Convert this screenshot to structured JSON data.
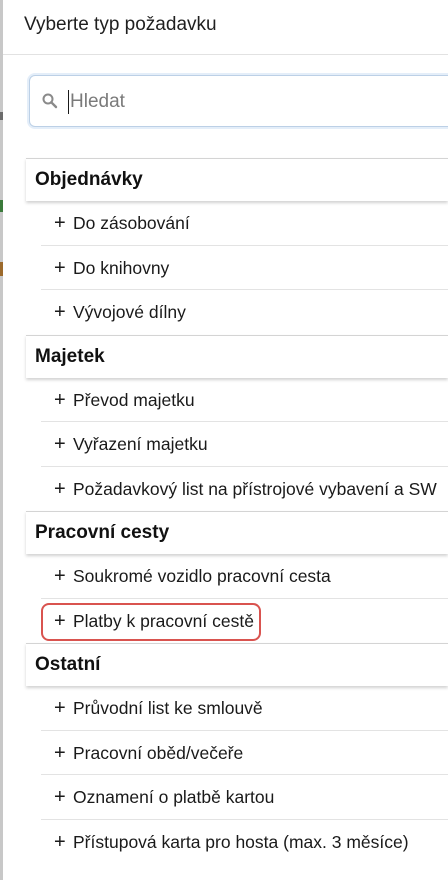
{
  "title": "Vyberte typ požadavku",
  "search": {
    "placeholder": "Hledat",
    "value": ""
  },
  "colors": {
    "highlight": "#d9534f",
    "search_border": "#bcd0e6"
  },
  "sections": [
    {
      "header": "Objednávky",
      "items": [
        {
          "label": "Do zásobování",
          "icon": "plus-icon"
        },
        {
          "label": "Do knihovny",
          "icon": "plus-icon"
        },
        {
          "label": "Vývojové dílny",
          "icon": "plus-icon"
        }
      ]
    },
    {
      "header": "Majetek",
      "items": [
        {
          "label": "Převod majetku",
          "icon": "plus-icon"
        },
        {
          "label": "Vyřazení majetku",
          "icon": "plus-icon"
        },
        {
          "label": "Požadavkový list na přístrojové vybavení a SW",
          "icon": "plus-icon"
        }
      ]
    },
    {
      "header": "Pracovní cesty",
      "items": [
        {
          "label": "Soukromé vozidlo pracovní cesta",
          "icon": "plus-icon"
        },
        {
          "label": "Platby k pracovní cestě",
          "icon": "plus-icon",
          "highlighted": true
        }
      ]
    },
    {
      "header": "Ostatní",
      "items": [
        {
          "label": "Průvodní list ke smlouvě",
          "icon": "plus-icon"
        },
        {
          "label": "Pracovní oběd/večeře",
          "icon": "plus-icon"
        },
        {
          "label": "Oznamení o platbě kartou",
          "icon": "plus-icon"
        },
        {
          "label": "Přístupová karta pro hosta (max. 3 měsíce)",
          "icon": "plus-icon"
        }
      ]
    }
  ]
}
